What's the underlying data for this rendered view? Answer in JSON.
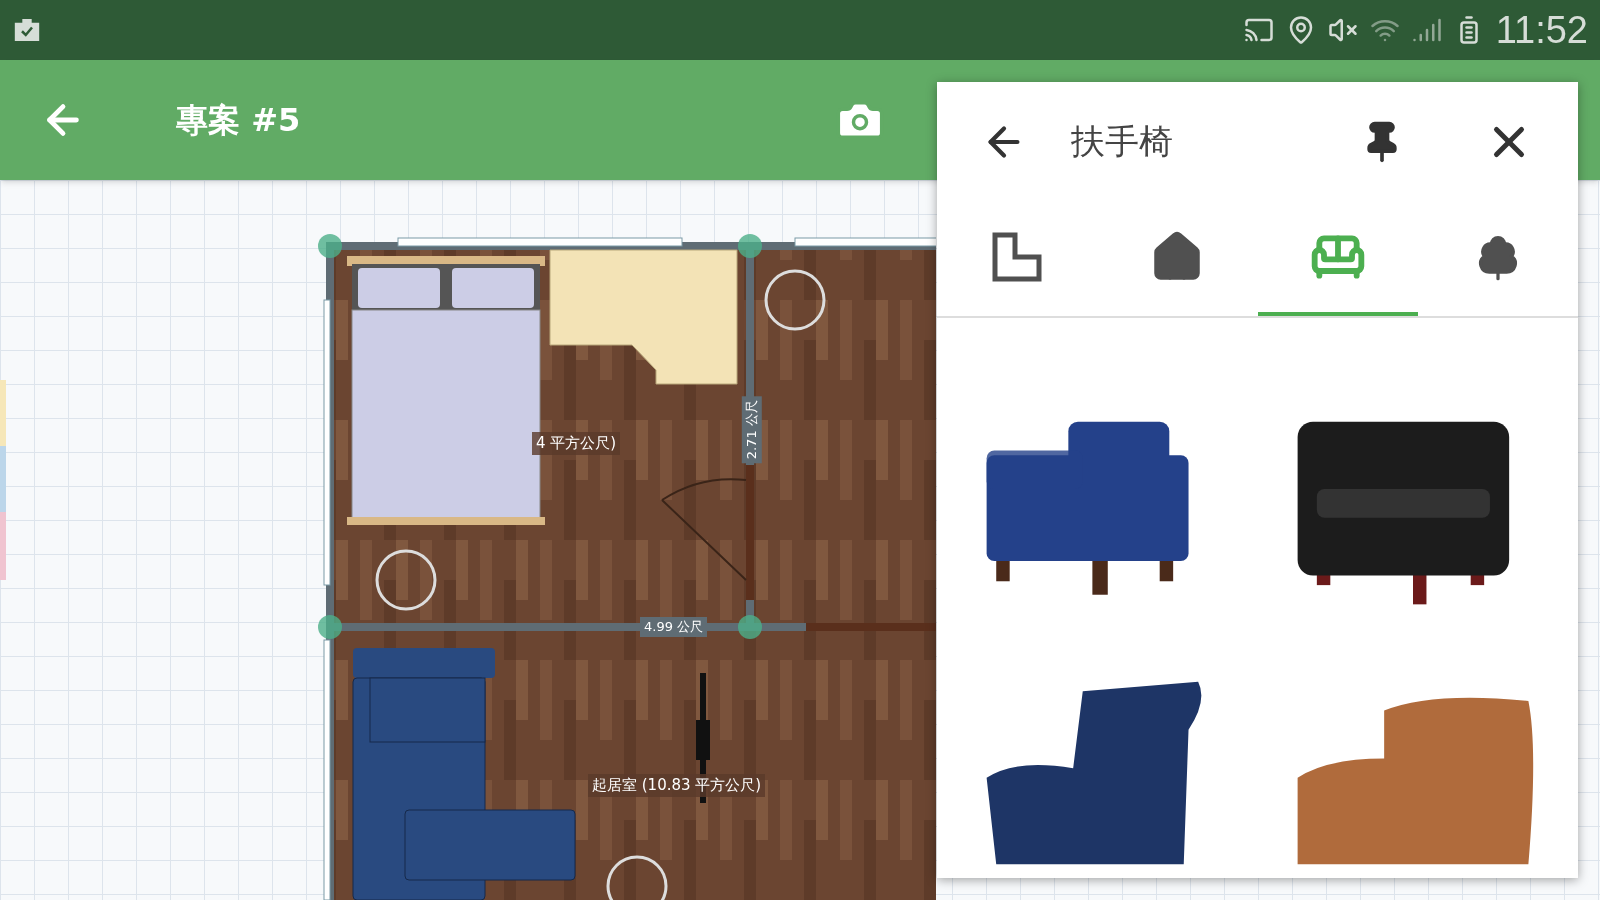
{
  "status_bar": {
    "time": "11:52"
  },
  "app_bar": {
    "title": "專案 #5"
  },
  "floor_plan": {
    "labels": [
      {
        "kind": "area",
        "text": "4 平方公尺)"
      },
      {
        "kind": "dimension_vertical",
        "text": "2.71 公尺"
      },
      {
        "kind": "dimension_horizontal",
        "text": "4.99 公尺"
      },
      {
        "kind": "area",
        "text": "起居室 (10.83 平方公尺)"
      }
    ]
  },
  "panel": {
    "title": "扶手椅",
    "tabs": [
      {
        "kind": "room",
        "selected": false
      },
      {
        "kind": "house",
        "selected": false
      },
      {
        "kind": "furniture",
        "selected": true
      },
      {
        "kind": "outdoor",
        "selected": false
      }
    ],
    "items": [
      {
        "kind": "square",
        "color": "#24418a"
      },
      {
        "kind": "club",
        "color": "#1c1c1c"
      },
      {
        "kind": "wing",
        "color": "#1e3566"
      },
      {
        "kind": "recliner",
        "color": "#b06b3c"
      }
    ]
  }
}
